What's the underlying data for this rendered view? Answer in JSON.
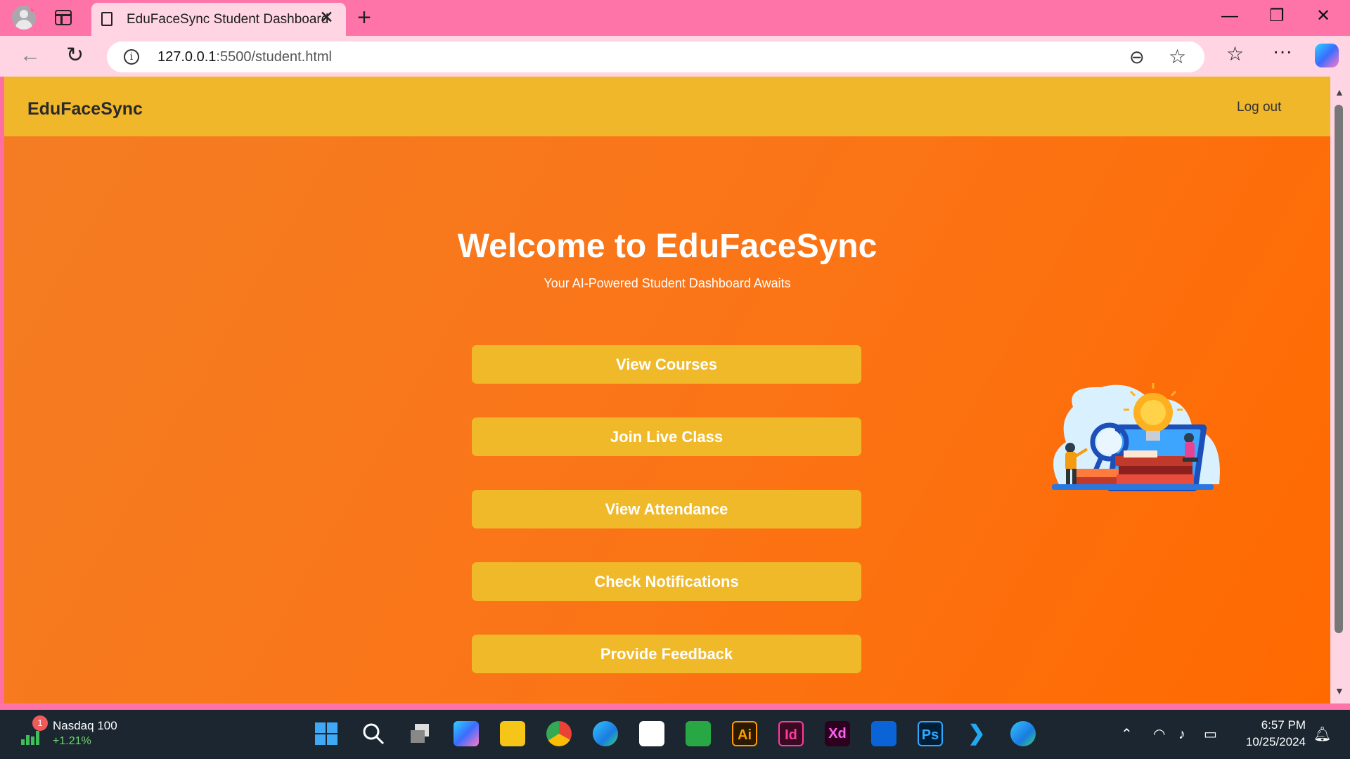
{
  "browser": {
    "tab_title": "EduFaceSync Student Dashboard",
    "url_host": "127.0.0.1",
    "url_path": ":5500/student.html"
  },
  "page": {
    "brand": "EduFaceSync",
    "logout_label": "Log out",
    "title": "Welcome to EduFaceSync",
    "subtitle": "Your AI-Powered Student Dashboard Awaits",
    "buttons": [
      {
        "label": "View Courses"
      },
      {
        "label": "Join Live Class"
      },
      {
        "label": "View Attendance"
      },
      {
        "label": "Check Notifications"
      },
      {
        "label": "Provide Feedback"
      }
    ]
  },
  "taskbar": {
    "widget_badge": "1",
    "widget_name": "Nasdaq 100",
    "widget_change": "+1.21%",
    "apps": [
      {
        "text": "Ai",
        "name": "illustrator-icon"
      },
      {
        "text": "Id",
        "name": "indesign-icon"
      },
      {
        "text": "Xd",
        "name": "xd-icon"
      },
      {
        "text": "Ps",
        "name": "photoshop-icon"
      }
    ],
    "time": "6:57 PM",
    "date": "10/25/2024"
  },
  "colors": {
    "navbar": "#f0b72a",
    "button": "#efb92a",
    "background_start": "#f47d23",
    "background_end": "#ff6900"
  }
}
